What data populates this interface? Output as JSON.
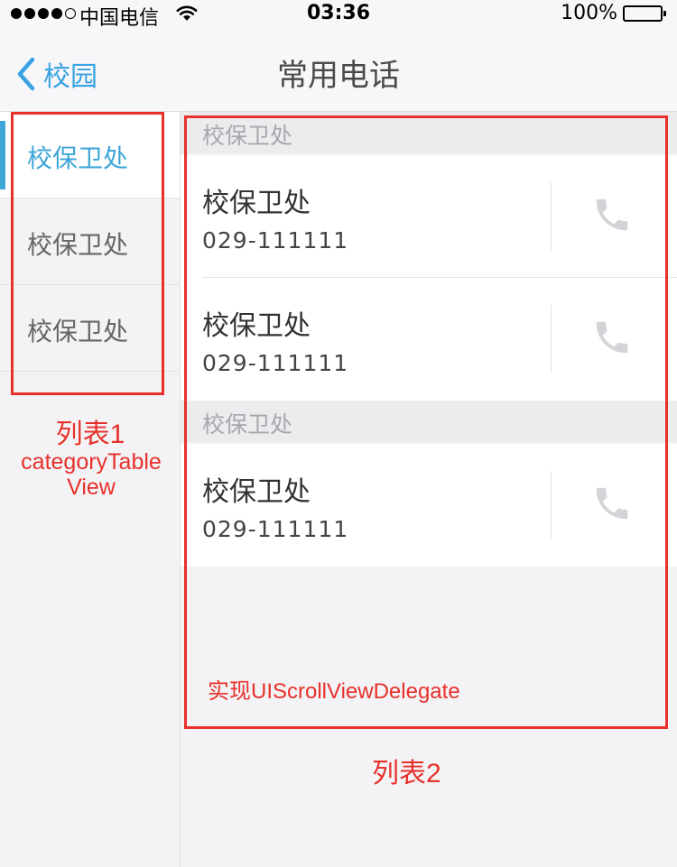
{
  "status_bar": {
    "carrier": "中国电信",
    "time": "03:36",
    "battery_percent": "100%",
    "battery_level": 1.0,
    "signal_bars": 4,
    "signal_total": 5,
    "icons": [
      "signal-dots-icon",
      "wifi-icon",
      "battery-icon"
    ]
  },
  "nav": {
    "back_label": "校园",
    "title": "常用电话",
    "back_icon": "chevron-left-icon"
  },
  "categories": [
    {
      "label": "校保卫处",
      "selected": true
    },
    {
      "label": "校保卫处",
      "selected": false
    },
    {
      "label": "校保卫处",
      "selected": false
    }
  ],
  "sections": [
    {
      "header": "校保卫处",
      "contacts": [
        {
          "name": "校保卫处",
          "phone": "029-111111"
        },
        {
          "name": "校保卫处",
          "phone": "029-111111"
        }
      ]
    },
    {
      "header": "校保卫处",
      "contacts": [
        {
          "name": "校保卫处",
          "phone": "029-111111"
        }
      ]
    }
  ],
  "annotations": {
    "list1": "列表1",
    "list1_sub1": "categoryTable",
    "list1_sub2": "View",
    "delegate": "实现UIScrollViewDelegate",
    "list2": "列表2"
  },
  "colors": {
    "accent": "#3fa6d8",
    "annotation": "#e8312b",
    "call_icon": "#d4d4d8"
  }
}
